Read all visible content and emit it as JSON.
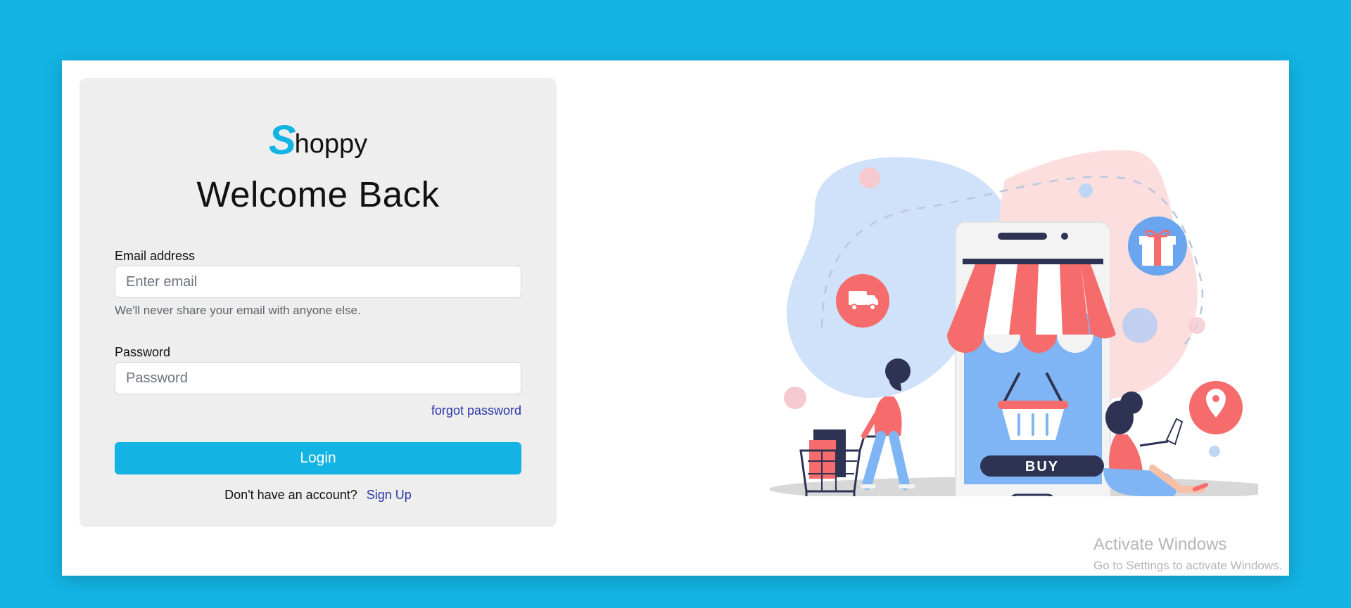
{
  "brand": {
    "logo_initial": "S",
    "logo_rest": "hoppy"
  },
  "login": {
    "title": "Welcome Back",
    "email_label": "Email address",
    "email_placeholder": "Enter email",
    "email_value": "",
    "email_help": "We'll never share your email with anyone else.",
    "password_label": "Password",
    "password_placeholder": "Password",
    "password_value": "",
    "forgot_link": "forgot password",
    "login_button": "Login",
    "signup_prompt": "Don't have an account?",
    "signup_link": "Sign Up"
  },
  "illustration": {
    "buy_label": "BUY"
  },
  "watermark": {
    "title": "Activate Windows",
    "subtitle": "Go to Settings to activate Windows."
  },
  "colors": {
    "accent": "#13b3e3",
    "link": "#2a36a8",
    "panel": "#eeeeee",
    "illustration_red": "#f66b6b",
    "illustration_blue": "#7fb5f4"
  }
}
